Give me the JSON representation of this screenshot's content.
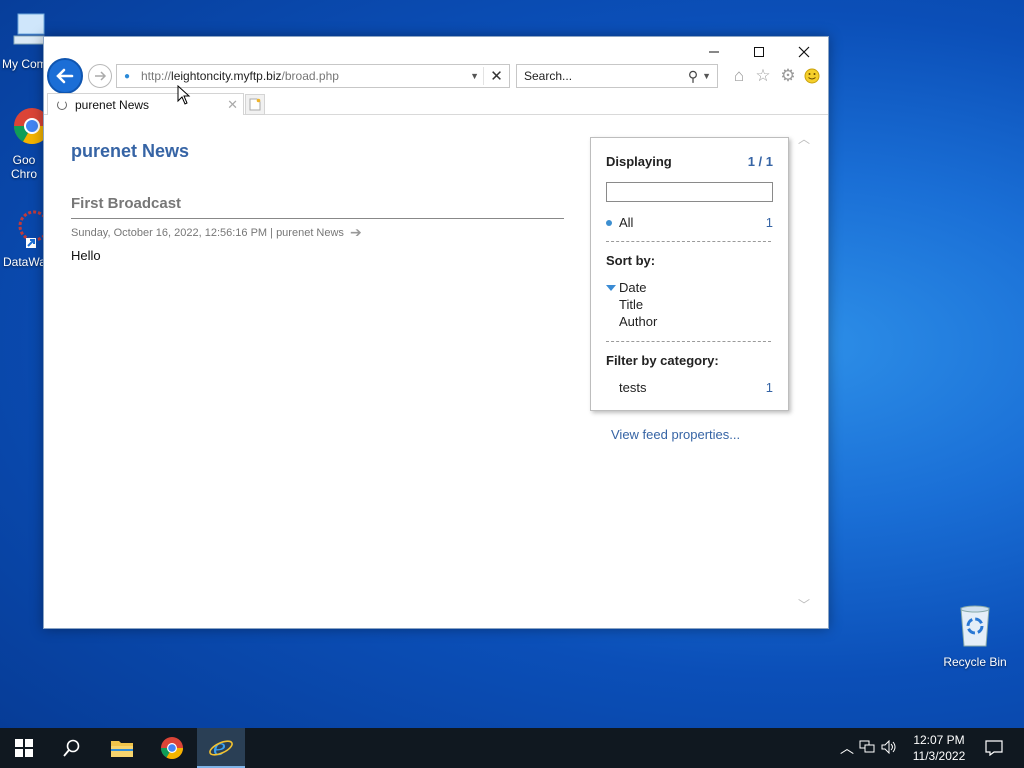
{
  "desktop": {
    "icons": [
      {
        "label": "My Com"
      },
      {
        "label": "Goo Chro"
      },
      {
        "label": "DataWa"
      },
      {
        "label": "Recycle Bin"
      }
    ]
  },
  "browser": {
    "url_prefix": "http://",
    "url_host": "leightoncity.myftp.biz",
    "url_path": "/broad.php",
    "search_placeholder": "Search...",
    "tab_title": "purenet News"
  },
  "page": {
    "feed_title": "purenet News",
    "item": {
      "title": "First Broadcast",
      "meta": "Sunday, October 16, 2022, 12:56:16 PM | purenet News",
      "body": "Hello"
    },
    "panel": {
      "displaying_label": "Displaying",
      "displaying_count": "1 / 1",
      "all_label": "All",
      "all_count": "1",
      "sort_heading": "Sort by:",
      "sort_options": [
        "Date",
        "Title",
        "Author"
      ],
      "filter_heading": "Filter by category:",
      "categories": [
        {
          "name": "tests",
          "count": "1"
        }
      ]
    },
    "view_feed_link": "View feed properties..."
  },
  "taskbar": {
    "time": "12:07 PM",
    "date": "11/3/2022"
  },
  "colors": {
    "link_blue": "#3664a5",
    "accent_blue": "#1b6ed6",
    "taskbar": "#101820"
  }
}
